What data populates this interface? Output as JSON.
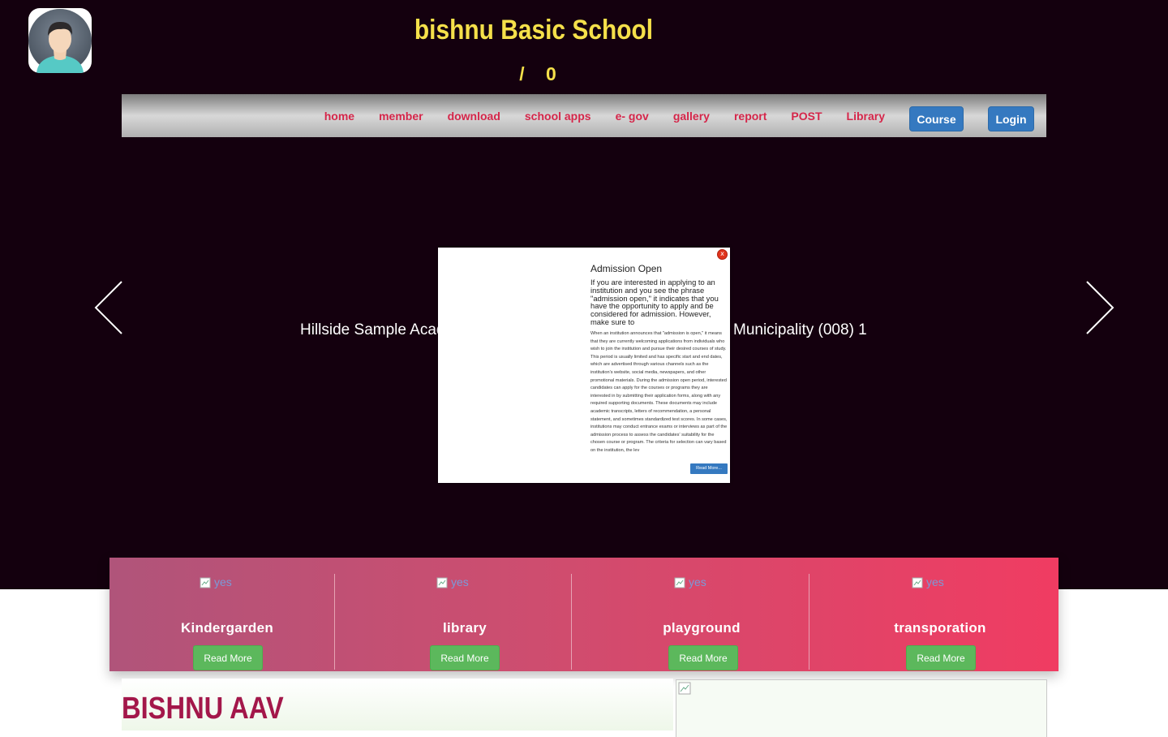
{
  "header": {
    "school_name": "bishnu Basic School",
    "counter_separator": "/",
    "counter_value": "0",
    "avatar_icon": "user-avatar-icon"
  },
  "nav": {
    "links": [
      "home",
      "member",
      "download",
      "school apps",
      "e- gov",
      "gallery",
      "report",
      "POST",
      "Library"
    ],
    "course_button": "Course",
    "login_button": "Login"
  },
  "slider": {
    "caption": "Hillside Sample Acad",
    "caption_right": "Municipality (008) 1",
    "prev_icon": "arrow-left-icon",
    "next_icon": "arrow-right-icon"
  },
  "popup": {
    "close_label": "x",
    "title": "Admission Open",
    "lead": "If you are interested in applying to an institution and you see the phrase \"admission open,\" it indicates that you have the opportunity to apply and be considered for admission. However, make sure to",
    "body": "When an institution announces that \"admission is open,\" it means that they are currently welcoming applications from individuals who wish to join the institution and pursue their desired courses of study. This period is usually limited and has specific start and end dates, which are advertised through various channels such as the institution's website, social media, newspapers, and other promotional materials. During the admission open period, interested candidates can apply for the courses or programs they are interested in by submitting their application forms, along with any required supporting documents. These documents may include academic transcripts, letters of recommendation, a personal statement, and sometimes standardized test scores. In some cases, institutions may conduct entrance exams or interviews as part of the admission process to assess the candidates' suitability for the chosen course or program. The criteria for selection can vary based on the institution, the lev",
    "read_more": "Read More..."
  },
  "features": [
    {
      "img_alt": "yes",
      "title": "Kindergarden",
      "button": "Read More"
    },
    {
      "img_alt": "yes",
      "title": "library",
      "button": "Read More"
    },
    {
      "img_alt": "yes",
      "title": "playground",
      "button": "Read More"
    },
    {
      "img_alt": "yes",
      "title": "transporation",
      "button": "Read More"
    }
  ],
  "about": {
    "title": "BISHNU AAV"
  },
  "colors": {
    "hero_bg": "#14000e",
    "title_yellow": "#f5e04a",
    "nav_link": "#d5264a",
    "button_blue": "#3579c0",
    "button_green": "#5cb85c",
    "about_title": "#a3174a"
  }
}
